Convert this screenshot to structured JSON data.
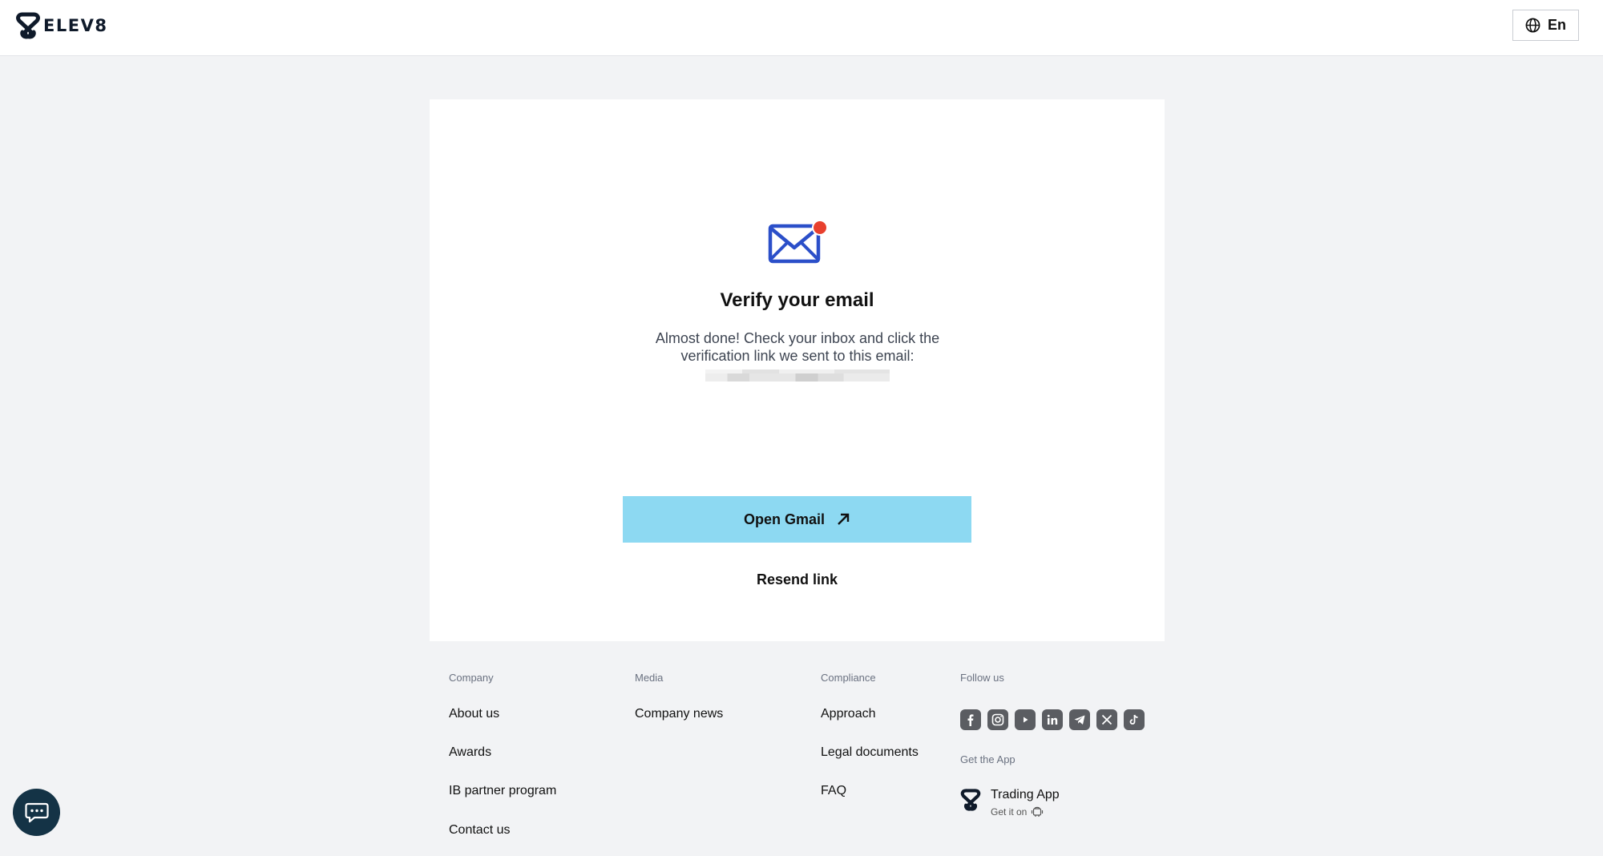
{
  "header": {
    "logo_text": "ELEV8",
    "language_label": "En"
  },
  "verify": {
    "title": "Verify your email",
    "description": "Almost done! Check your inbox and click the verification link we sent to this email:",
    "open_button_label": "Open Gmail",
    "resend_label": "Resend link"
  },
  "footer": {
    "company": {
      "heading": "Company",
      "links": [
        "About us",
        "Awards",
        "IB partner program",
        "Contact us"
      ]
    },
    "media": {
      "heading": "Media",
      "links": [
        "Company news"
      ]
    },
    "compliance": {
      "heading": "Compliance",
      "links": [
        "Approach",
        "Legal documents",
        "FAQ"
      ]
    },
    "follow": {
      "heading": "Follow us",
      "icons": [
        "facebook-icon",
        "instagram-icon",
        "youtube-icon",
        "linkedin-icon",
        "telegram-icon",
        "x-icon",
        "tiktok-icon"
      ]
    },
    "app": {
      "heading": "Get the App",
      "name": "Trading App",
      "sub_label": "Get it on"
    }
  },
  "colors": {
    "accent": "#8dd9f2",
    "mail_blue": "#2b4fc9",
    "notification_red": "#e8402e",
    "chat_bg": "#143346"
  }
}
